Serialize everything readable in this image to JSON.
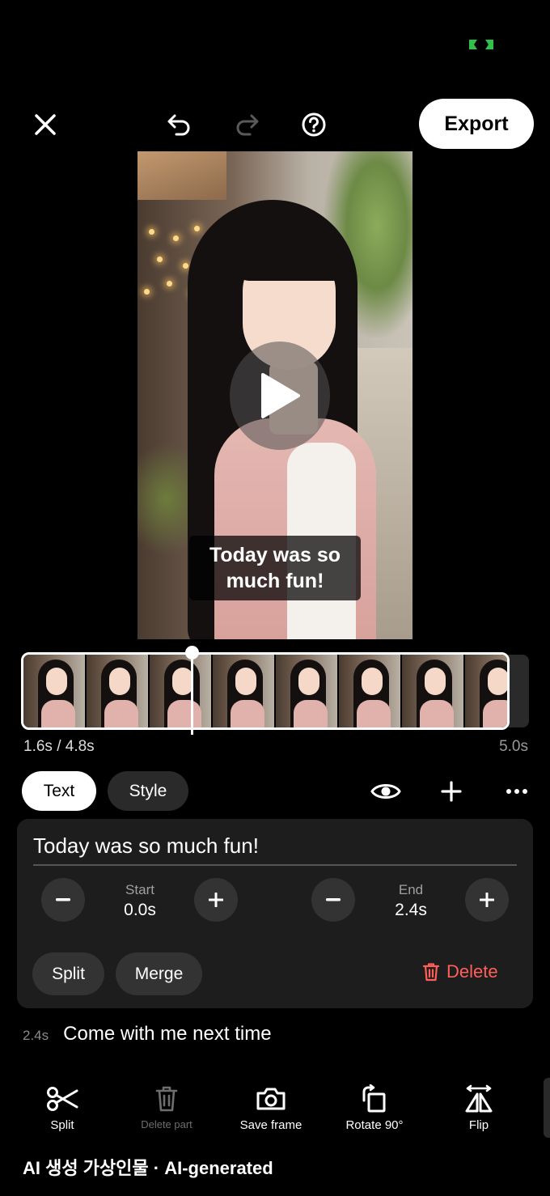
{
  "status": {
    "indicator_icon": "connection-indicator-icon",
    "indicator_color": "#2ec24a"
  },
  "header": {
    "close_icon": "close-icon",
    "undo_icon": "undo-icon",
    "redo_icon": "redo-icon",
    "help_icon": "help-icon",
    "export_label": "Export"
  },
  "preview": {
    "play_icon": "play-icon",
    "caption_overlay": "Today was so much fun!"
  },
  "timeline": {
    "current_time": "1.6s / 4.8s",
    "total_time": "5.0s",
    "playhead_progress": 0.33
  },
  "tabs": [
    {
      "label": "Text",
      "active": true
    },
    {
      "label": "Style",
      "active": false
    }
  ],
  "toolbar_icons": [
    "eye-icon",
    "plus-icon",
    "more-icon"
  ],
  "caption_editor": {
    "text": "Today was so much fun!",
    "start_label": "Start",
    "start_value": "0.0s",
    "end_label": "End",
    "end_value": "2.4s",
    "split_label": "Split",
    "merge_label": "Merge",
    "delete_label": "Delete",
    "delete_color": "#ff5f5a"
  },
  "next_caption": {
    "time": "2.4s",
    "text": "Come with me next time"
  },
  "bottom_tools": [
    {
      "label": "Split",
      "icon": "scissors-icon",
      "enabled": true
    },
    {
      "label": "Delete part",
      "icon": "trash-icon",
      "enabled": false
    },
    {
      "label": "Save frame",
      "icon": "camera-icon",
      "enabled": true
    },
    {
      "label": "Rotate 90°",
      "icon": "rotate-icon",
      "enabled": true
    },
    {
      "label": "Flip",
      "icon": "flip-icon",
      "enabled": true
    }
  ],
  "watermark": "AI 생성 가상인물 · AI-generated"
}
